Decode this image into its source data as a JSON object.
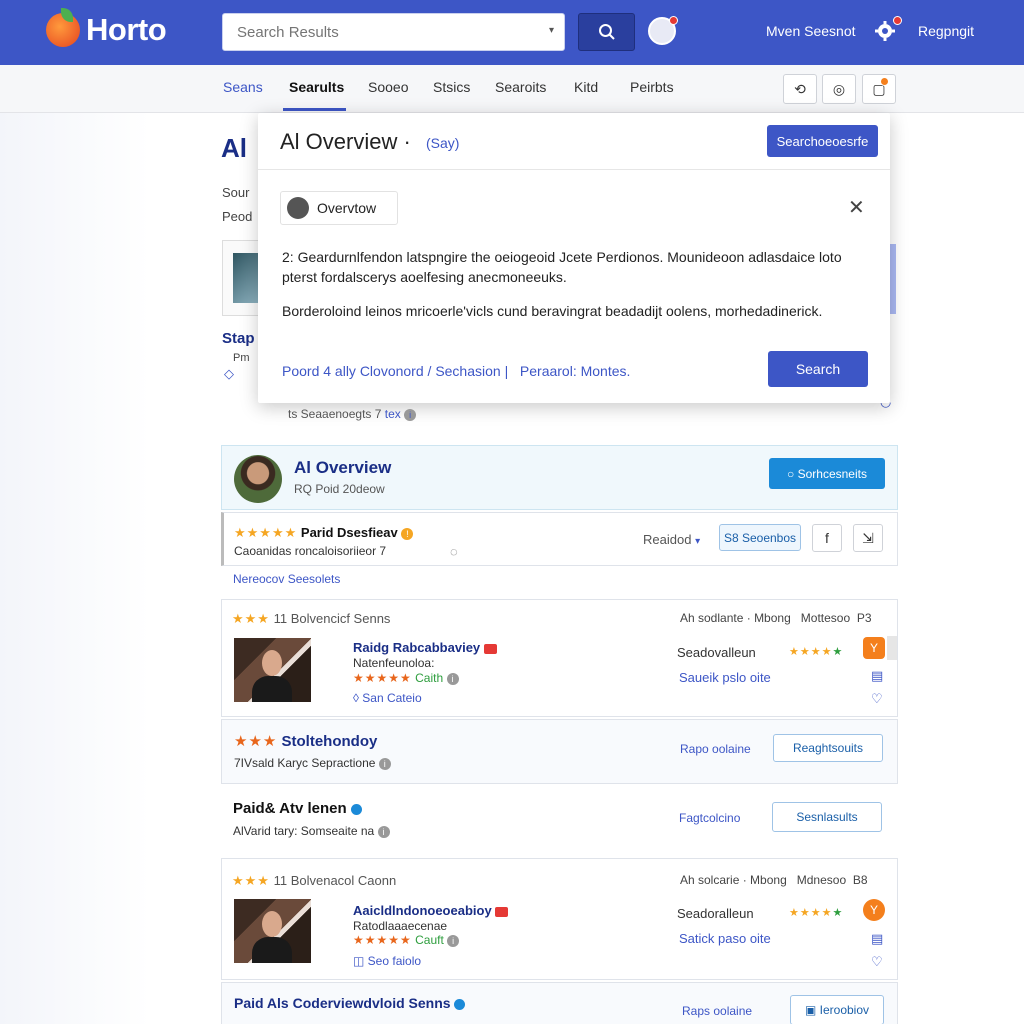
{
  "header": {
    "logo": "Horto",
    "search_placeholder": "Search Results",
    "user_text": "Mven Seesnot",
    "right_link": "Regpngit"
  },
  "tabs": [
    "Seans",
    "Searults",
    "Sooeo",
    "Stsics",
    "Searoits",
    "Kitd",
    "Peirbts"
  ],
  "background": {
    "title": "Al",
    "line1": "Sour",
    "line2": "Peod",
    "side_label": "Stap",
    "side_label2": "Pm",
    "under_line": "ts Seaaenoegts 7",
    "under_link": "tex"
  },
  "popup": {
    "title": "Al Overview ·",
    "title_sub": "(Say)",
    "head_button": "Searchoeoesrfe",
    "chip_label": "Overvtow",
    "para1": "2: Geardurnlfendon latspngire the oeiogeoid Jcete Perdionos. Mounideoon adlasdaice loto pterst fordalscerys aoelfesing anecmoneeuks.",
    "para2": "Borderoloind leinos mricoerle'vicls cund beravingrat beadadijt oolens, morhedadinerick.",
    "link1": "Poord 4 ally Clovonord",
    "link2": "Sechasion",
    "link3": "Peraarol: Montes.",
    "button": "Search"
  },
  "overview_card": {
    "title": "Al Overview",
    "subtitle": "RQ Poid 20deow",
    "button": "Sorhcesneits"
  },
  "result1": {
    "title": "Parid Dsesfieav",
    "sub": "Caoanidas roncaloisoriieor 7",
    "link": "Nereocov Seesolets",
    "dropdown": "Reaidod",
    "badge": "S8 Seoenbos"
  },
  "result2": {
    "header": "11 Bolvencicf Senns",
    "meta1": "Ah sodlante",
    "meta2": "Mbong",
    "meta3": "Mottesoo",
    "meta4": "P3",
    "name": "Raidg Rabcabbaviey",
    "name_sub": "Natenfeunoloa:",
    "rating_text": "Caith",
    "place": "San Cateio",
    "right_label": "Seadovalleun",
    "right_link": "Saueik pslo oite"
  },
  "result3": {
    "title": "Stoltehondoy",
    "sub": "7IVsald Karyc Sepractione",
    "link": "Rapo oolaine",
    "button": "Reaghtsouits"
  },
  "result4": {
    "title": "Paid& Atv lenen",
    "sub": "AlVarid tary: Somseaite na",
    "link": "Fagtcolcino",
    "button": "Sesnlasults"
  },
  "result5": {
    "header": "11 Bolvenacol Caonn",
    "meta1": "Ah solcarie",
    "meta2": "Mbong",
    "meta3": "Mdnesoo",
    "meta4": "B8",
    "name": "Aaicldlndonoeoeabioy",
    "name_sub": "Ratodlaaaecenae",
    "rating_text": "Cauft",
    "place": "Seo faiolo",
    "right_label": "Seadoralleun",
    "right_link": "Satick paso oite"
  },
  "result6": {
    "title": "Paid Als Coderviewdvloid Senns",
    "link": "Raps oolaine",
    "button": "Ieroobiov"
  },
  "colors": {
    "brand": "#3d56c6",
    "accent_blue": "#1b8ad8",
    "star": "#f5a623"
  }
}
